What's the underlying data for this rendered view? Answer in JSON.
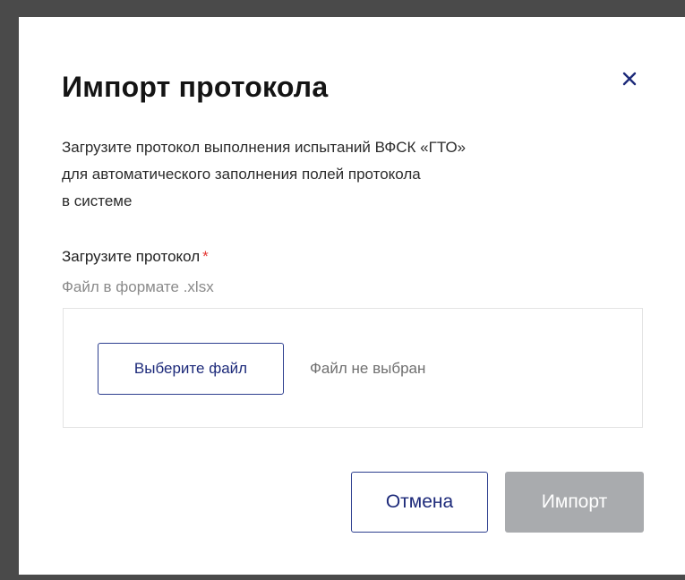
{
  "dialog": {
    "title": "Импорт протокола",
    "close_icon": "close-icon",
    "description": [
      "Загрузите протокол выполнения испытаний ВФСК «ГТО»",
      "для автоматического заполнения полей протокола",
      "в системе"
    ]
  },
  "upload": {
    "label": "Загрузите протокол",
    "required_mark": "*",
    "hint": "Файл в формате .xlsx",
    "choose_button": "Выберите файл",
    "status": "Файл не выбран"
  },
  "actions": {
    "cancel": "Отмена",
    "import": "Импорт",
    "import_disabled": true
  },
  "colors": {
    "accent": "#1d2a7a",
    "required": "#e53935",
    "disabled_button": "#a9abae",
    "backdrop": "#4a4a4a"
  }
}
